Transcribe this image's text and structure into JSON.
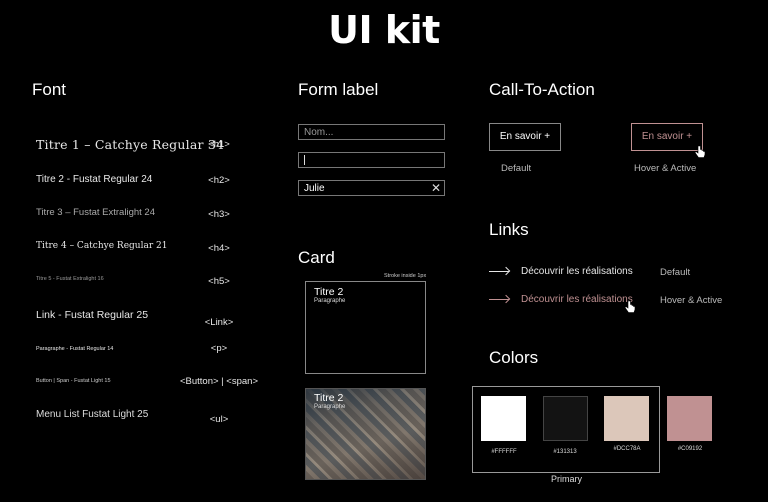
{
  "title": "UI kit",
  "font": {
    "heading": "Font",
    "rows": [
      {
        "label": "Titre 1 – Catchye Regular 34",
        "tag": "<h1>"
      },
      {
        "label": "Titre 2 - Fustat Regular 24",
        "tag": "<h2>"
      },
      {
        "label": "Titre 3 – Fustat Extralight 24",
        "tag": "<h3>"
      },
      {
        "label": "Titre 4 – Catchye Regular 21",
        "tag": "<h4>"
      },
      {
        "label": "Titre 5 - Fustat Extralight 16",
        "tag": "<h5>"
      },
      {
        "label": "Link - Fustat Regular 25",
        "tag": "<Link>"
      },
      {
        "label": "Paragraphe - Fustat Regular 14",
        "tag": "<p>"
      },
      {
        "label": "Button | Span - Fustat Light 15",
        "tag": "<Button> | <span>"
      },
      {
        "label": "Menu List Fustat Light 25",
        "tag": "<ul>"
      }
    ]
  },
  "form": {
    "heading": "Form label",
    "fields": [
      {
        "placeholder": "Nom...",
        "value": ""
      },
      {
        "placeholder": "",
        "value": "",
        "state": "focus"
      },
      {
        "placeholder": "",
        "value": "Julie",
        "state": "filled"
      }
    ]
  },
  "card": {
    "heading": "Card",
    "stroke_note": "Stroke inside 1px",
    "cards": [
      {
        "title": "Titre 2",
        "subtitle": "Paragraphe"
      },
      {
        "title": "Titre 2",
        "subtitle": "Paragraphe"
      }
    ]
  },
  "cta": {
    "heading": "Call-To-Action",
    "button_label": "En savoir +",
    "default_caption": "Default",
    "hover_caption": "Hover & Active"
  },
  "links": {
    "heading": "Links",
    "items": [
      {
        "label": "Découvrir les réalisations",
        "caption": "Default"
      },
      {
        "label": "Découvrir les réalisations",
        "caption": "Hover & Active"
      }
    ]
  },
  "colors": {
    "heading": "Colors",
    "primary_label": "Primary",
    "swatches": [
      {
        "hex": "#FFFFFF",
        "label": "#FFFFFF"
      },
      {
        "hex": "#131313",
        "label": "#131313"
      },
      {
        "hex": "#DCC7BA",
        "label": "#DCC78A"
      },
      {
        "hex": "#C09192",
        "label": "#C09192"
      }
    ]
  }
}
